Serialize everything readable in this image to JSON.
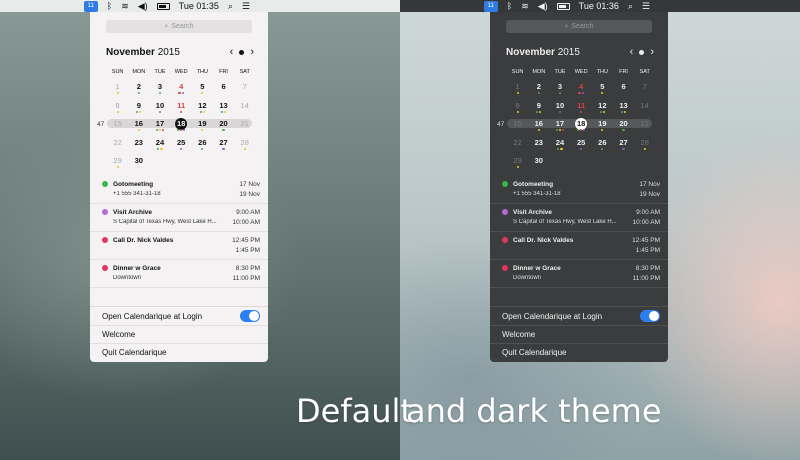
{
  "menubar_left": {
    "time": "Tue 01:35",
    "calendar_icon_label": "11"
  },
  "menubar_right": {
    "time": "Tue 01:36",
    "calendar_icon_label": "11"
  },
  "search": {
    "placeholder": "Search"
  },
  "calendar": {
    "month": "November",
    "year": "2015",
    "weekdays": [
      "SUN",
      "MON",
      "TUE",
      "WED",
      "THU",
      "FRI",
      "SAT"
    ],
    "weeks": [
      {
        "number": "",
        "days": [
          {
            "d": "1",
            "dim": true,
            "dots": [
              "#f5c518"
            ]
          },
          {
            "d": "2",
            "dots": [
              "#3ab54a"
            ]
          },
          {
            "d": "3",
            "dots": [
              "#3ab54a"
            ]
          },
          {
            "d": "4",
            "red": true,
            "dots": [
              "#d9443f",
              "#8a5fd6"
            ]
          },
          {
            "d": "5",
            "dots": [
              "#f5c518"
            ]
          },
          {
            "d": "6",
            "dots": []
          },
          {
            "d": "7",
            "dim": true,
            "dots": []
          }
        ]
      },
      {
        "number": "",
        "days": [
          {
            "d": "8",
            "dim": true,
            "dots": [
              "#f5c518"
            ]
          },
          {
            "d": "9",
            "dots": [
              "#3ab54a",
              "#f5c518"
            ]
          },
          {
            "d": "10",
            "dots": [
              "#8a5fd6"
            ]
          },
          {
            "d": "11",
            "red": true,
            "dots": [
              "#d9443f"
            ]
          },
          {
            "d": "12",
            "dots": [
              "#3ab54a",
              "#f5c518"
            ]
          },
          {
            "d": "13",
            "dots": [
              "#3ab54a",
              "#f5c518"
            ]
          },
          {
            "d": "14",
            "dim": true,
            "dots": []
          }
        ]
      },
      {
        "number": "47",
        "current": true,
        "days": [
          {
            "d": "15",
            "dim": true,
            "dots": []
          },
          {
            "d": "16",
            "dots": [
              "#f5c518"
            ]
          },
          {
            "d": "17",
            "dots": [
              "#3ab54a",
              "#f5c518",
              "#d9443f"
            ]
          },
          {
            "d": "18",
            "sel": true,
            "dots": [
              "#3ab54a",
              "#d9443f",
              "#8a5fd6"
            ]
          },
          {
            "d": "19",
            "dots": [
              "#f5c518"
            ]
          },
          {
            "d": "20",
            "dots": [
              "#3ab54a"
            ]
          },
          {
            "d": "21",
            "dim": true,
            "dots": []
          }
        ]
      },
      {
        "number": "",
        "days": [
          {
            "d": "22",
            "dim": true,
            "dots": []
          },
          {
            "d": "23",
            "dots": []
          },
          {
            "d": "24",
            "dots": [
              "#3ab54a",
              "#f5c518"
            ]
          },
          {
            "d": "25",
            "dots": [
              "#8a5fd6"
            ]
          },
          {
            "d": "26",
            "dots": [
              "#3ab54a"
            ]
          },
          {
            "d": "27",
            "dots": [
              "#8a5fd6"
            ]
          },
          {
            "d": "28",
            "dim": true,
            "dots": [
              "#f5c518"
            ]
          }
        ]
      },
      {
        "number": "",
        "days": [
          {
            "d": "29",
            "dim": true,
            "dots": [
              "#f5c518"
            ]
          },
          {
            "d": "30",
            "dots": []
          }
        ]
      }
    ]
  },
  "events": [
    {
      "title": "Gotomeeting",
      "subtitle": "+1 555 341-31-18",
      "start": "17 Nov",
      "end": "19 Nov",
      "color": "#3ab54a"
    },
    {
      "title": "Visit Archive",
      "subtitle": "S Capital of Texas Hwy, West Lake H...",
      "start": "9:00 AM",
      "end": "10:00 AM",
      "color": "#b26ad6"
    },
    {
      "title": "Call Dr. Nick Valdes",
      "subtitle": "",
      "start": "12:45 PM",
      "end": "1:45 PM",
      "color": "#e4345e"
    },
    {
      "title": "Dinner w Grace",
      "subtitle": "Downtown",
      "start": "8:30 PM",
      "end": "11:00 PM",
      "color": "#e4345e"
    }
  ],
  "footer": {
    "open_at_login": "Open Calendarique at Login",
    "welcome": "Welcome",
    "quit": "Quit Calendarique"
  },
  "caption": {
    "part1": "Default",
    "part2": "and dark theme"
  }
}
